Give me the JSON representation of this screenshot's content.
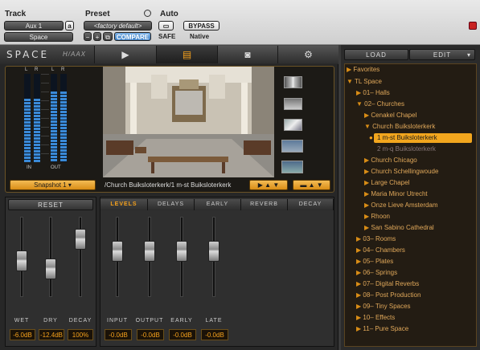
{
  "header": {
    "track_label": "Track",
    "preset_label": "Preset",
    "auto_label": "Auto",
    "track_name": "Aux 1",
    "track_sub": "a",
    "plugin_name": "Space",
    "preset_name": "<factory default>",
    "minus": "−",
    "plus": "+",
    "compare": "COMPARE",
    "safe": "SAFE",
    "bypass": "BYPASS",
    "native": "Native"
  },
  "plugin": {
    "brand": "SPACE",
    "brand_suffix": "H/AAX",
    "meters": {
      "in_label": "IN",
      "out_label": "OUT",
      "l": "L",
      "r": "R",
      "in_left_level": 0.72,
      "in_right_level": 0.72,
      "out_left_level": 0.8,
      "out_right_level": 0.8
    },
    "snapshot": "Snapshot 1",
    "path": "/Church Buiksloterkerk/1 m-st Buiksloterkerk",
    "reset": "RESET",
    "tabs": [
      "LEVELS",
      "DELAYS",
      "EARLY",
      "REVERB",
      "DECAY"
    ],
    "left_faders": [
      {
        "label": "WET",
        "value": "-6.0dB",
        "level": 0.45
      },
      {
        "label": "DRY",
        "value": "-12.4dB",
        "level": 0.32
      },
      {
        "label": "DECAY",
        "value": "100%",
        "level": 0.8
      }
    ],
    "right_faders": [
      {
        "label": "INPUT",
        "value": "-0.0dB",
        "level": 0.6
      },
      {
        "label": "OUTPUT",
        "value": "-0.0dB",
        "level": 0.6
      },
      {
        "label": "EARLY",
        "value": "-0.0dB",
        "level": 0.6
      },
      {
        "label": "LATE",
        "value": "-0.0dB",
        "level": 0.6
      }
    ]
  },
  "browser": {
    "load": "LOAD",
    "edit": "EDIT",
    "items": [
      {
        "text": "Favorites",
        "style": "orange"
      },
      {
        "text": "TL Space",
        "style": "orange"
      },
      {
        "text": "01– Halls",
        "style": "orange"
      },
      {
        "text": "02– Churches",
        "style": "orange"
      },
      {
        "text": "Cenakel Chapel",
        "style": "orange"
      },
      {
        "text": "Church Buiksloterkerk",
        "style": "orange"
      },
      {
        "text": "1 m-st Buiksloterkerk",
        "style": "selected"
      },
      {
        "text": "2 m-q Buiksloterkerk",
        "style": "dim"
      },
      {
        "text": "Church Chicago",
        "style": "orange"
      },
      {
        "text": "Church Schellingwoude",
        "style": "orange"
      },
      {
        "text": "Large Chapel",
        "style": "orange"
      },
      {
        "text": "Maria Minor Utrecht",
        "style": "orange"
      },
      {
        "text": "Onze Lieve Amsterdam",
        "style": "orange"
      },
      {
        "text": "Rhoon",
        "style": "orange"
      },
      {
        "text": "San Sabino Cathedral",
        "style": "orange"
      },
      {
        "text": "03– Rooms",
        "style": "orange"
      },
      {
        "text": "04– Chambers",
        "style": "orange"
      },
      {
        "text": "05– Plates",
        "style": "orange"
      },
      {
        "text": "06– Springs",
        "style": "orange"
      },
      {
        "text": "07– Digital Reverbs",
        "style": "orange"
      },
      {
        "text": "08– Post Production",
        "style": "orange"
      },
      {
        "text": "09– Tiny Spaces",
        "style": "orange"
      },
      {
        "text": "10– Effects",
        "style": "orange"
      },
      {
        "text": "11– Pure Space",
        "style": "orange"
      }
    ]
  },
  "colors": {
    "accent": "#f7a21c",
    "meter": "#3a8ad8",
    "panel": "#272727"
  }
}
